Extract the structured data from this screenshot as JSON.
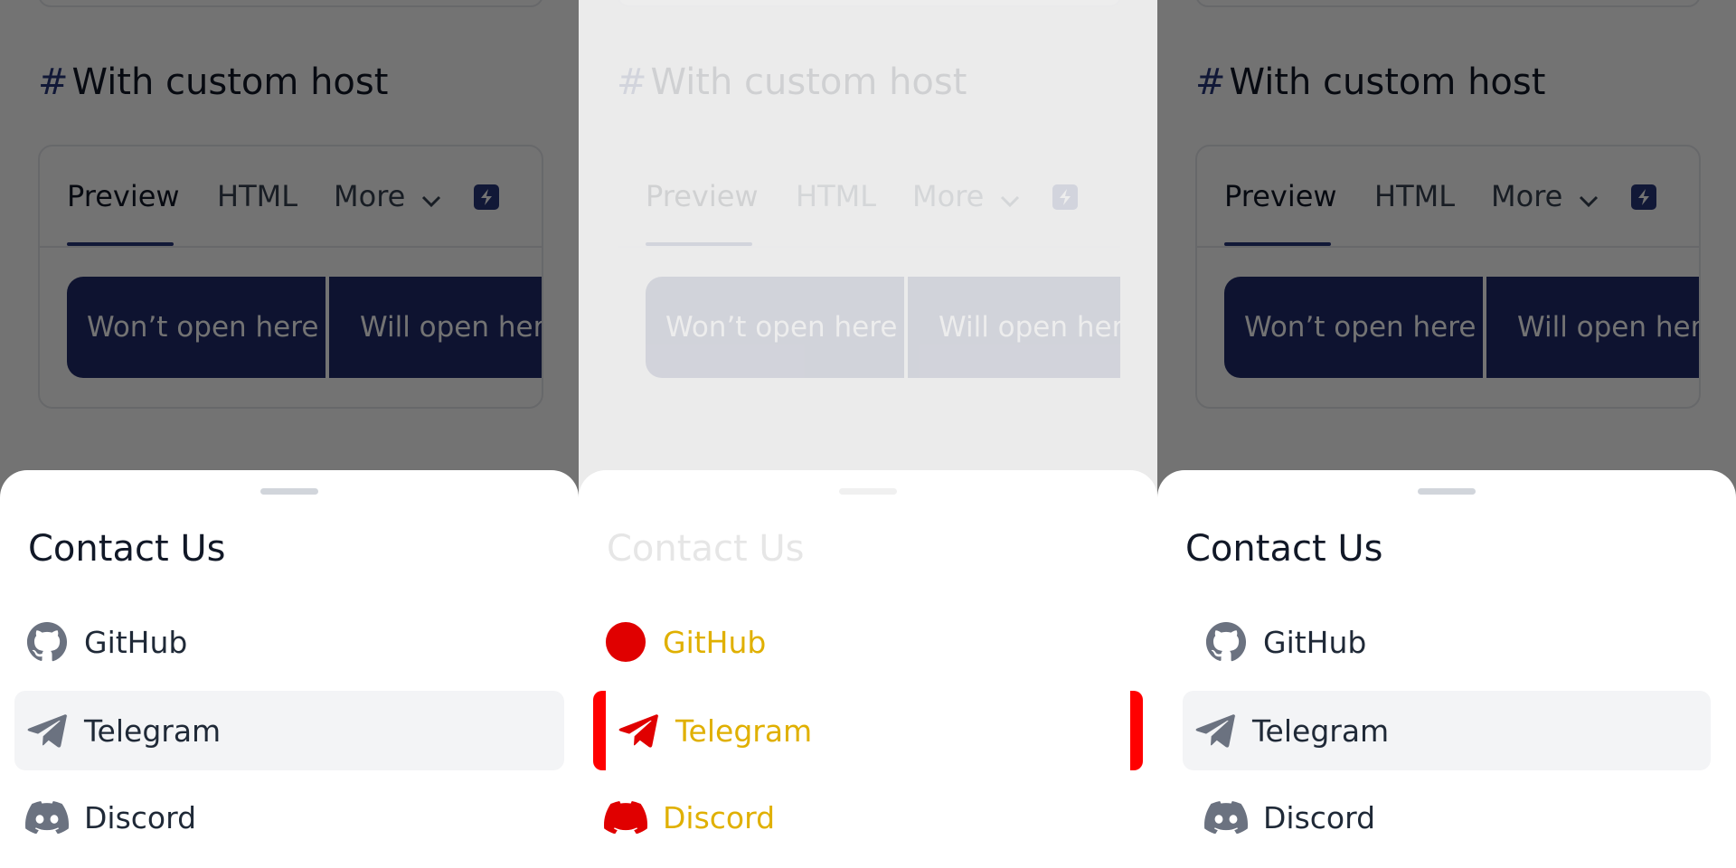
{
  "section": {
    "hash": "#",
    "title": "With custom host"
  },
  "tabs": {
    "preview": "Preview",
    "html": "HTML",
    "more": "More"
  },
  "buttons": {
    "wont_open": "Won’t open here",
    "will_open": "Will open here"
  },
  "sheet": {
    "title": "Contact Us",
    "items": [
      {
        "label": "GitHub",
        "icon": "github-icon"
      },
      {
        "label": "Telegram",
        "icon": "telegram-icon"
      },
      {
        "label": "Discord",
        "icon": "discord-icon"
      }
    ]
  },
  "colors": {
    "accent": "#27357a",
    "button": "#1f2b6a",
    "overlay": "rgba(0,0,0,0.55)",
    "active_row": "#f3f4f6",
    "diff_red": "#ff0000",
    "diff_yellow": "#e0b000"
  }
}
